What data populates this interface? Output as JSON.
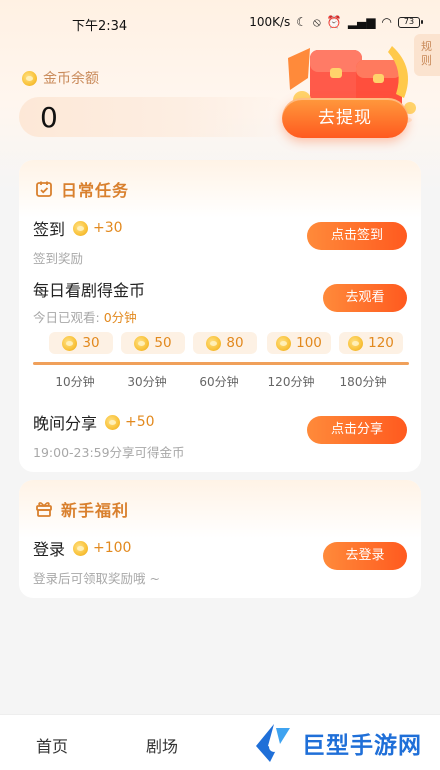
{
  "status_bar": {
    "time": "下午2:34",
    "speed": "100K/s",
    "battery": "73"
  },
  "rules_tab": {
    "label": "规则"
  },
  "balance": {
    "label": "金币余额",
    "value": "0",
    "withdraw_label": "去提现"
  },
  "daily": {
    "title": "日常任务",
    "checkin": {
      "title": "签到",
      "reward": "+30",
      "sub": "签到奖励",
      "button": "点击签到"
    },
    "watch": {
      "title": "每日看剧得金币",
      "sub_prefix": "今日已观看: ",
      "sub_value": "0分钟",
      "button": "去观看",
      "milestones": [
        {
          "coins": "30",
          "time": "10分钟"
        },
        {
          "coins": "50",
          "time": "30分钟"
        },
        {
          "coins": "80",
          "time": "60分钟"
        },
        {
          "coins": "100",
          "time": "120分钟"
        },
        {
          "coins": "120",
          "time": "180分钟"
        }
      ]
    },
    "share": {
      "title": "晚间分享",
      "reward": "+50",
      "sub": "19:00-23:59分享可得金币",
      "button": "点击分享"
    }
  },
  "newbie": {
    "title": "新手福利",
    "login": {
      "title": "登录",
      "reward": "+100",
      "sub": "登录后可领取奖励哦 ~",
      "button": "去登录"
    }
  },
  "tabbar": {
    "items": [
      "首页",
      "剧场"
    ]
  },
  "watermark": {
    "text": "巨型手游网"
  },
  "colors": {
    "accent": "#ff5a1f",
    "gold": "#e2891e",
    "title": "#d9802e"
  }
}
